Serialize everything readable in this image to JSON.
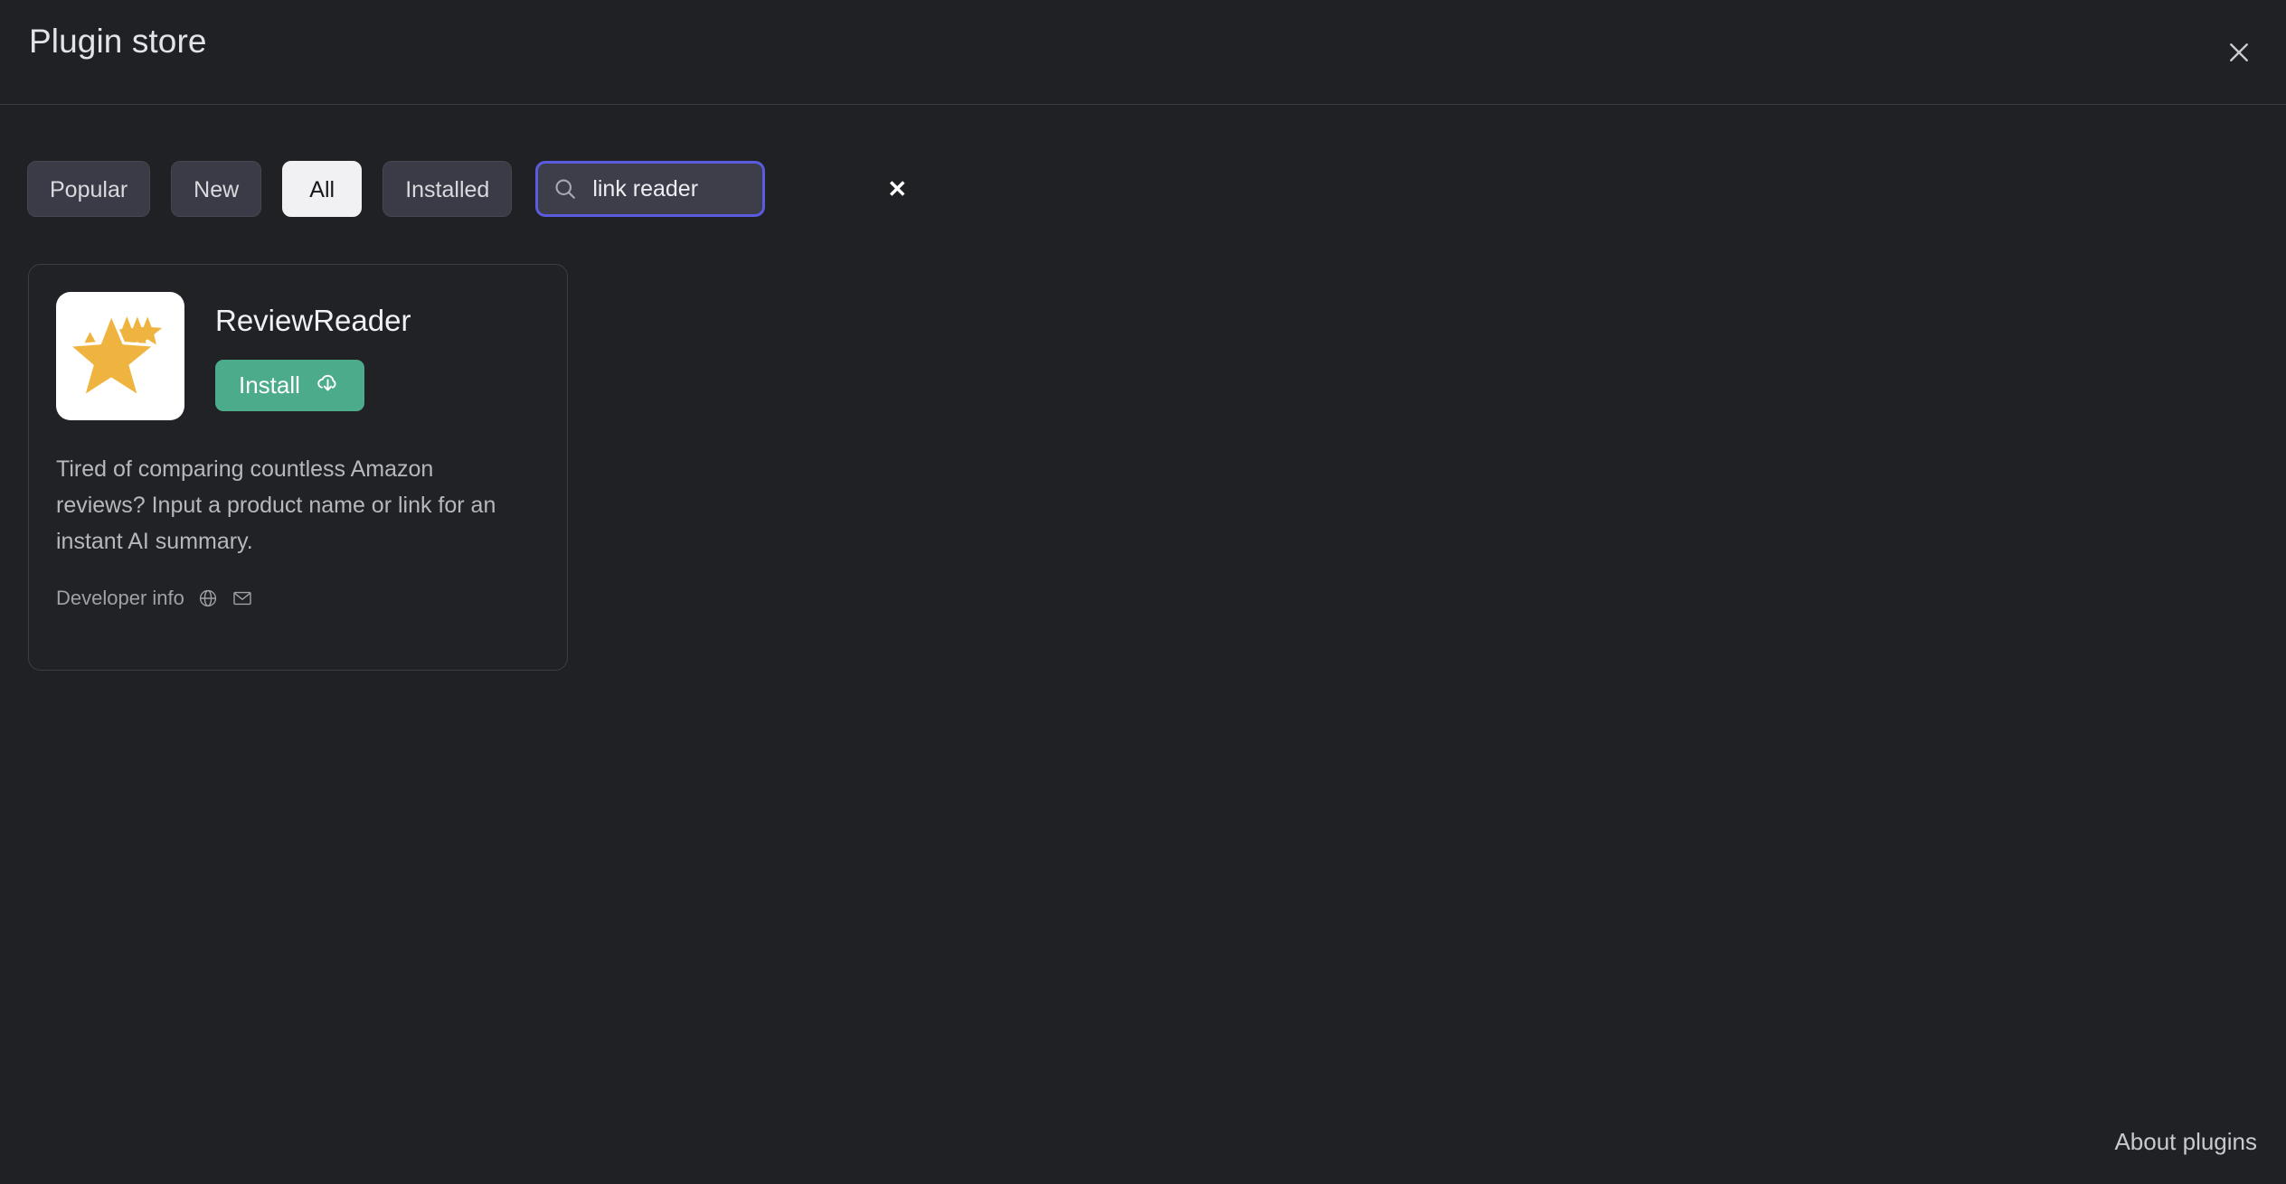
{
  "window": {
    "title": "Plugin store",
    "close_icon": "close-icon"
  },
  "toolbar": {
    "filters": [
      {
        "label": "Popular",
        "active": false
      },
      {
        "label": "New",
        "active": false
      },
      {
        "label": "All",
        "active": true
      },
      {
        "label": "Installed",
        "active": false
      }
    ],
    "search": {
      "value": "link reader",
      "placeholder": "Search plugins",
      "search_icon": "search-icon",
      "clear_icon": "clear-icon",
      "focused": true,
      "focus_color": "#5b5be0"
    }
  },
  "results": {
    "plugins": [
      {
        "name": "ReviewReader",
        "icon": "star-trail-icon",
        "icon_color": "#efb440",
        "install_label": "Install",
        "install_icon": "cloud-download-icon",
        "install_color": "#4cab8a",
        "description": "Tired of comparing countless Amazon reviews? Input a product name or link for an instant AI summary.",
        "developer_label": "Developer info",
        "developer_links": [
          {
            "icon": "globe-icon"
          },
          {
            "icon": "mail-icon"
          }
        ]
      }
    ]
  },
  "footer": {
    "about_label": "About plugins"
  }
}
